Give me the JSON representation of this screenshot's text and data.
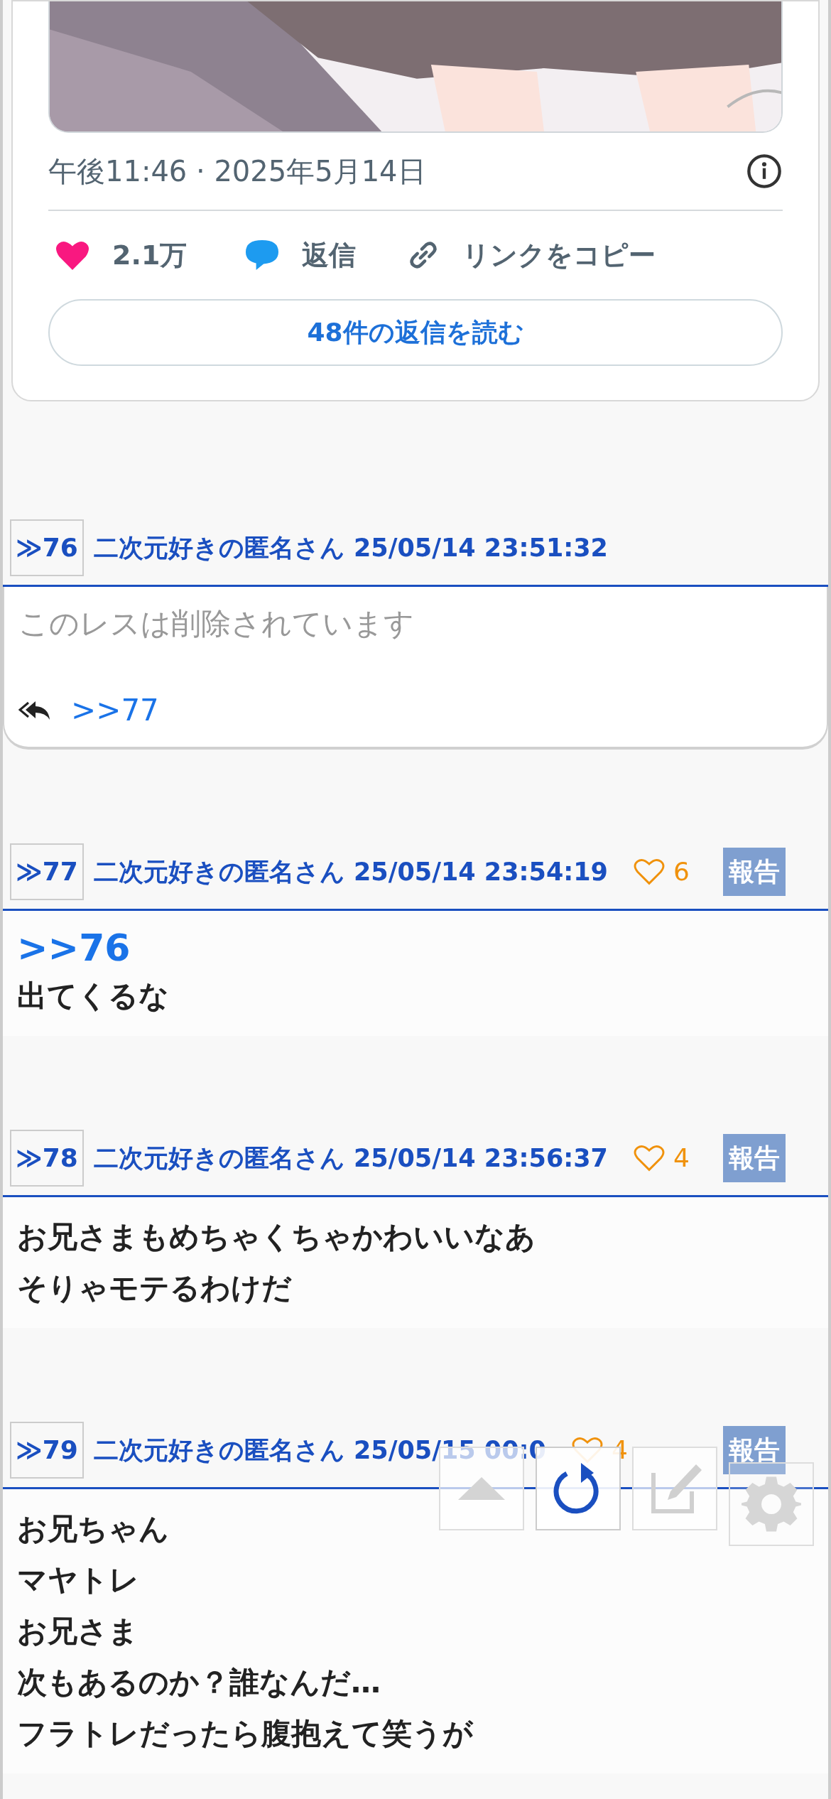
{
  "embed": {
    "timestamp": "午後11:46 · 2025年5月14日",
    "likes": "2.1万",
    "reply_label": "返信",
    "copy_link": "リンクをコピー",
    "read_replies": "48件の返信を読む"
  },
  "posts": [
    {
      "number": "≫76",
      "name": "二次元好きの匿名さん",
      "date": "25/05/14 23:51:32",
      "deleted": true,
      "body": [
        "このレスは削除されています"
      ],
      "replies": [
        ">>77"
      ]
    },
    {
      "number": "≫77",
      "name": "二次元好きの匿名さん",
      "date": "25/05/14 23:54:19",
      "deleted": false,
      "likes": "6",
      "report": "報告",
      "anchor": ">>76",
      "body": [
        "出てくるな"
      ]
    },
    {
      "number": "≫78",
      "name": "二次元好きの匿名さん",
      "date": "25/05/14 23:56:37",
      "deleted": false,
      "likes": "4",
      "report": "報告",
      "body": [
        "お兄さまもめちゃくちゃかわいいなあ",
        "そりゃモテるわけだ"
      ]
    },
    {
      "number": "≫79",
      "name": "二次元好きの匿名さん",
      "date": "25/05/15 00:0",
      "deleted": false,
      "likes": "4",
      "report": "報告",
      "body": [
        "お兄ちゃん",
        "マヤトレ",
        "お兄さま",
        "次もあるのか？誰なんだ…",
        "フラトレだったら腹抱えて笑うが"
      ]
    }
  ]
}
